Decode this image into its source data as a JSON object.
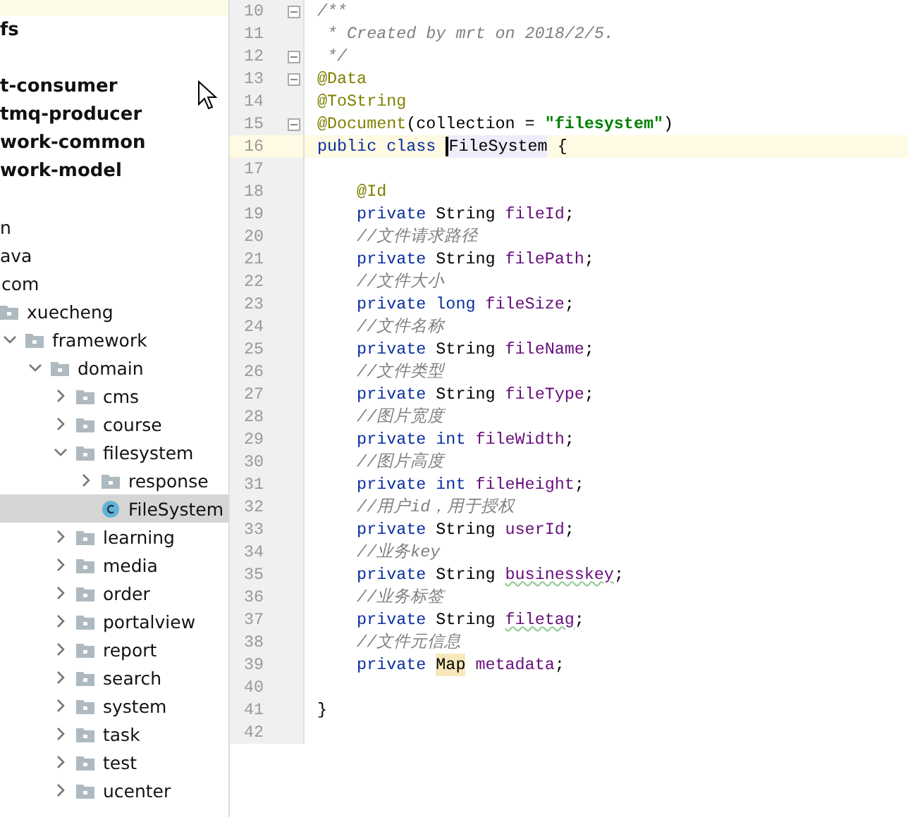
{
  "project_tree": {
    "items": [
      {
        "kind": "offscreen",
        "selected": false
      },
      {
        "kind": "module",
        "label": "fs",
        "selected": false
      },
      {
        "kind": "offscreen",
        "selected": false
      },
      {
        "kind": "module",
        "label": "t-consumer",
        "selected": false
      },
      {
        "kind": "module",
        "label": "tmq-producer",
        "selected": false
      },
      {
        "kind": "module",
        "label": "work-common",
        "selected": false
      },
      {
        "kind": "module",
        "label": "work-model",
        "selected": false
      },
      {
        "kind": "offscreen",
        "selected": false
      },
      {
        "kind": "cut",
        "label": "n",
        "selected": false
      },
      {
        "kind": "cut",
        "label": "ava",
        "selected": false
      },
      {
        "kind": "folder",
        "label": "com",
        "expanded": true,
        "selected": false,
        "children": [
          {
            "kind": "folder",
            "label": "xuecheng",
            "expanded": true,
            "selected": false,
            "children": [
              {
                "kind": "folder",
                "label": "framework",
                "expanded": true,
                "selected": false,
                "children": [
                  {
                    "kind": "folder",
                    "label": "domain",
                    "expanded": true,
                    "selected": false,
                    "children": [
                      {
                        "kind": "folder",
                        "label": "cms",
                        "expanded": false,
                        "selected": false
                      },
                      {
                        "kind": "folder",
                        "label": "course",
                        "expanded": false,
                        "selected": false
                      },
                      {
                        "kind": "folder",
                        "label": "filesystem",
                        "expanded": true,
                        "selected": false,
                        "children": [
                          {
                            "kind": "folder",
                            "label": "response",
                            "expanded": false,
                            "selected": false
                          },
                          {
                            "kind": "class",
                            "label": "FileSystem",
                            "selected": true
                          }
                        ]
                      },
                      {
                        "kind": "folder",
                        "label": "learning",
                        "expanded": false,
                        "selected": false
                      },
                      {
                        "kind": "folder",
                        "label": "media",
                        "expanded": false,
                        "selected": false
                      },
                      {
                        "kind": "folder",
                        "label": "order",
                        "expanded": false,
                        "selected": false
                      },
                      {
                        "kind": "folder",
                        "label": "portalview",
                        "expanded": false,
                        "selected": false
                      },
                      {
                        "kind": "folder",
                        "label": "report",
                        "expanded": false,
                        "selected": false
                      },
                      {
                        "kind": "folder",
                        "label": "search",
                        "expanded": false,
                        "selected": false
                      },
                      {
                        "kind": "folder",
                        "label": "system",
                        "expanded": false,
                        "selected": false
                      },
                      {
                        "kind": "folder",
                        "label": "task",
                        "expanded": false,
                        "selected": false
                      },
                      {
                        "kind": "folder",
                        "label": "test",
                        "expanded": false,
                        "selected": false
                      },
                      {
                        "kind": "folder",
                        "label": "ucenter",
                        "expanded": false,
                        "selected": false
                      }
                    ]
                  }
                ]
              }
            ]
          }
        ]
      }
    ]
  },
  "editor": {
    "lines": [
      {
        "number": "10",
        "fold": true,
        "current": false,
        "tokens": [
          {
            "kind": "comment",
            "text": "/**"
          }
        ]
      },
      {
        "number": "11",
        "fold": false,
        "current": false,
        "tokens": [
          {
            "kind": "comment",
            "text": " * Created by mrt on 2018/2/5."
          }
        ]
      },
      {
        "number": "12",
        "fold": true,
        "current": false,
        "tokens": [
          {
            "kind": "comment",
            "text": " */"
          }
        ]
      },
      {
        "number": "13",
        "fold": true,
        "current": false,
        "tokens": [
          {
            "kind": "annotation",
            "text": "@Data"
          }
        ]
      },
      {
        "number": "14",
        "fold": false,
        "current": false,
        "tokens": [
          {
            "kind": "annotation",
            "text": "@ToString"
          }
        ]
      },
      {
        "number": "15",
        "fold": true,
        "current": false,
        "tokens": [
          {
            "kind": "annotation",
            "text": "@Document"
          },
          {
            "kind": "plain",
            "text": "(collection = "
          },
          {
            "kind": "string",
            "text": "\"filesystem\""
          },
          {
            "kind": "plain",
            "text": ")"
          }
        ]
      },
      {
        "number": "16",
        "fold": false,
        "current": true,
        "tokens": [
          {
            "kind": "keyword",
            "text": "public class "
          },
          {
            "kind": "plain",
            "text": "FileSystem",
            "marked": true,
            "caret": true
          },
          {
            "kind": "plain",
            "text": " {"
          }
        ]
      },
      {
        "number": "17",
        "fold": false,
        "current": false
      },
      {
        "number": "18",
        "fold": false,
        "current": false,
        "tokens": [
          {
            "kind": "annotation",
            "text": "    @Id"
          }
        ]
      },
      {
        "number": "19",
        "fold": false,
        "current": false,
        "tokens": [
          {
            "kind": "keyword",
            "text": "    private "
          },
          {
            "kind": "plain",
            "text": "String "
          },
          {
            "kind": "field",
            "text": "fileId"
          },
          {
            "kind": "plain",
            "text": ";"
          }
        ]
      },
      {
        "number": "20",
        "fold": false,
        "current": false,
        "tokens": [
          {
            "kind": "comment",
            "text": "    //文件请求路径"
          }
        ]
      },
      {
        "number": "21",
        "fold": false,
        "current": false,
        "tokens": [
          {
            "kind": "keyword",
            "text": "    private "
          },
          {
            "kind": "plain",
            "text": "String "
          },
          {
            "kind": "field",
            "text": "filePath"
          },
          {
            "kind": "plain",
            "text": ";"
          }
        ]
      },
      {
        "number": "22",
        "fold": false,
        "current": false,
        "tokens": [
          {
            "kind": "comment",
            "text": "    //文件大小"
          }
        ]
      },
      {
        "number": "23",
        "fold": false,
        "current": false,
        "tokens": [
          {
            "kind": "keyword",
            "text": "    private long "
          },
          {
            "kind": "field",
            "text": "fileSize"
          },
          {
            "kind": "plain",
            "text": ";"
          }
        ]
      },
      {
        "number": "24",
        "fold": false,
        "current": false,
        "tokens": [
          {
            "kind": "comment",
            "text": "    //文件名称"
          }
        ]
      },
      {
        "number": "25",
        "fold": false,
        "current": false,
        "tokens": [
          {
            "kind": "keyword",
            "text": "    private "
          },
          {
            "kind": "plain",
            "text": "String "
          },
          {
            "kind": "field",
            "text": "fileName"
          },
          {
            "kind": "plain",
            "text": ";"
          }
        ]
      },
      {
        "number": "26",
        "fold": false,
        "current": false,
        "tokens": [
          {
            "kind": "comment",
            "text": "    //文件类型"
          }
        ]
      },
      {
        "number": "27",
        "fold": false,
        "current": false,
        "tokens": [
          {
            "kind": "keyword",
            "text": "    private "
          },
          {
            "kind": "plain",
            "text": "String "
          },
          {
            "kind": "field",
            "text": "fileType"
          },
          {
            "kind": "plain",
            "text": ";"
          }
        ]
      },
      {
        "number": "28",
        "fold": false,
        "current": false,
        "tokens": [
          {
            "kind": "comment",
            "text": "    //图片宽度"
          }
        ]
      },
      {
        "number": "29",
        "fold": false,
        "current": false,
        "tokens": [
          {
            "kind": "keyword",
            "text": "    private int "
          },
          {
            "kind": "field",
            "text": "fileWidth"
          },
          {
            "kind": "plain",
            "text": ";"
          }
        ]
      },
      {
        "number": "30",
        "fold": false,
        "current": false,
        "tokens": [
          {
            "kind": "comment",
            "text": "    //图片高度"
          }
        ]
      },
      {
        "number": "31",
        "fold": false,
        "current": false,
        "tokens": [
          {
            "kind": "keyword",
            "text": "    private int "
          },
          {
            "kind": "field",
            "text": "fileHeight"
          },
          {
            "kind": "plain",
            "text": ";"
          }
        ]
      },
      {
        "number": "32",
        "fold": false,
        "current": false,
        "tokens": [
          {
            "kind": "comment",
            "text": "    //用户id，用于授权"
          }
        ]
      },
      {
        "number": "33",
        "fold": false,
        "current": false,
        "tokens": [
          {
            "kind": "keyword",
            "text": "    private "
          },
          {
            "kind": "plain",
            "text": "String "
          },
          {
            "kind": "field",
            "text": "userId"
          },
          {
            "kind": "plain",
            "text": ";"
          }
        ]
      },
      {
        "number": "34",
        "fold": false,
        "current": false,
        "tokens": [
          {
            "kind": "comment",
            "text": "    //业务key"
          }
        ]
      },
      {
        "number": "35",
        "fold": false,
        "current": false,
        "tokens": [
          {
            "kind": "keyword",
            "text": "    private "
          },
          {
            "kind": "plain",
            "text": "String "
          },
          {
            "kind": "field",
            "text": "businesskey",
            "warning": true
          },
          {
            "kind": "plain",
            "text": ";"
          }
        ]
      },
      {
        "number": "36",
        "fold": false,
        "current": false,
        "tokens": [
          {
            "kind": "comment",
            "text": "    //业务标签"
          }
        ]
      },
      {
        "number": "37",
        "fold": false,
        "current": false,
        "tokens": [
          {
            "kind": "keyword",
            "text": "    private "
          },
          {
            "kind": "plain",
            "text": "String "
          },
          {
            "kind": "field",
            "text": "filetag",
            "warning": true
          },
          {
            "kind": "plain",
            "text": ";"
          }
        ]
      },
      {
        "number": "38",
        "fold": false,
        "current": false,
        "tokens": [
          {
            "kind": "comment",
            "text": "    //文件元信息"
          }
        ]
      },
      {
        "number": "39",
        "fold": false,
        "current": false,
        "tokens": [
          {
            "kind": "keyword",
            "text": "    private "
          },
          {
            "kind": "plain",
            "text": "Map",
            "marked": true
          },
          {
            "kind": "field",
            "text": " metadata"
          },
          {
            "kind": "plain",
            "text": ";"
          }
        ]
      },
      {
        "number": "40",
        "fold": false,
        "current": false
      },
      {
        "number": "41",
        "fold": false,
        "current": false,
        "tokens": [
          {
            "kind": "plain",
            "text": "}"
          }
        ]
      },
      {
        "number": "42",
        "fold": false,
        "current": false
      }
    ]
  }
}
